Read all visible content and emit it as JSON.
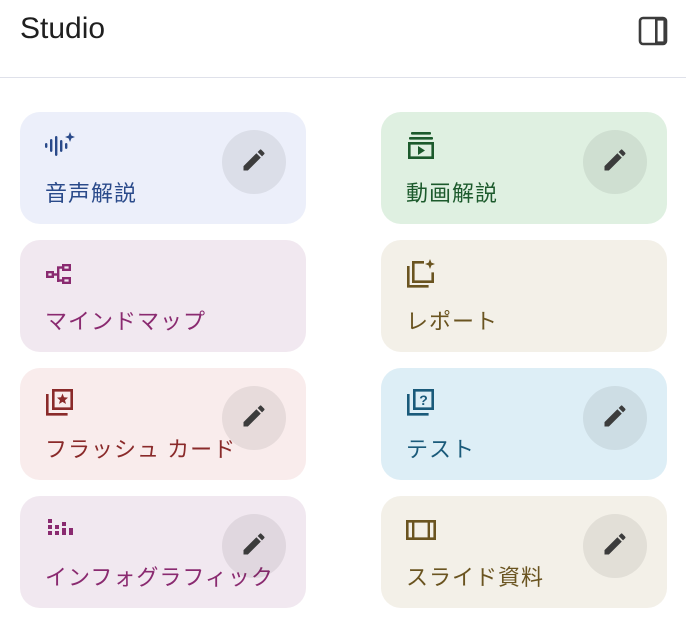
{
  "header": {
    "title": "Studio",
    "panel_icon": "side-panel-icon"
  },
  "cards": [
    {
      "label": "音声解説",
      "icon": "audio-sparkle-icon",
      "bg": "#eceffa",
      "fg": "#2a4a8a",
      "edit": true
    },
    {
      "label": "動画解説",
      "icon": "video-play-icon",
      "bg": "#dff0e1",
      "fg": "#1c5a2c",
      "edit": true
    },
    {
      "label": "マインドマップ",
      "icon": "mind-map-icon",
      "bg": "#f1e8f0",
      "fg": "#8a2a70",
      "edit": false
    },
    {
      "label": "レポート",
      "icon": "report-sparkle-icon",
      "bg": "#f3f0e8",
      "fg": "#6a5420",
      "edit": false
    },
    {
      "label": "フラッシュ カード",
      "icon": "flashcard-star-icon",
      "bg": "#f9ecec",
      "fg": "#8a2a2a",
      "edit": true
    },
    {
      "label": "テスト",
      "icon": "quiz-question-icon",
      "bg": "#ddeef6",
      "fg": "#1a5a7a",
      "edit": true
    },
    {
      "label": "インフォグラフィック",
      "icon": "infographic-bars-icon",
      "bg": "#f1e8f0",
      "fg": "#8a2a70",
      "edit": true
    },
    {
      "label": "スライド資料",
      "icon": "slides-icon",
      "bg": "#f3f0e8",
      "fg": "#6a5420",
      "edit": true
    }
  ],
  "edit_icon": "pencil-icon"
}
